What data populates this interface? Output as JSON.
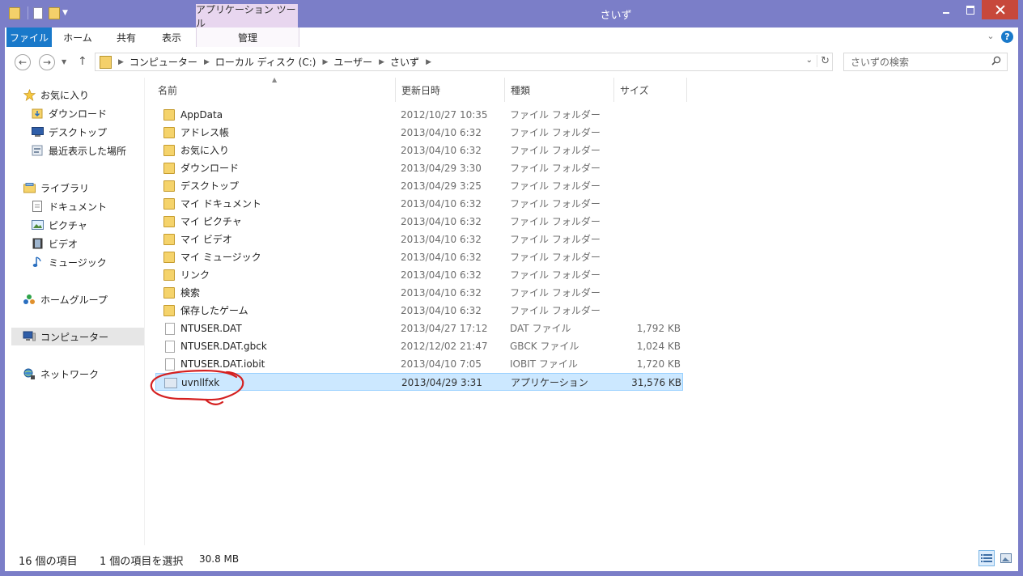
{
  "window": {
    "title": "さいず",
    "context_tab_title": "アプリケーション ツール"
  },
  "ribbon": {
    "tabs": [
      {
        "label": "ファイル"
      },
      {
        "label": "ホーム"
      },
      {
        "label": "共有"
      },
      {
        "label": "表示"
      },
      {
        "label": "管理"
      }
    ],
    "help": "?"
  },
  "address": {
    "crumbs": [
      "コンピューター",
      "ローカル ディスク (C:)",
      "ユーザー",
      "さいず"
    ]
  },
  "search": {
    "placeholder": "さいずの検索"
  },
  "nav": {
    "items": [
      {
        "label": "お気に入り"
      },
      {
        "label": "ダウンロード"
      },
      {
        "label": "デスクトップ"
      },
      {
        "label": "最近表示した場所"
      },
      {
        "label": "ライブラリ"
      },
      {
        "label": "ドキュメント"
      },
      {
        "label": "ピクチャ"
      },
      {
        "label": "ビデオ"
      },
      {
        "label": "ミュージック"
      },
      {
        "label": "ホームグループ"
      },
      {
        "label": "コンピューター"
      },
      {
        "label": "ネットワーク"
      }
    ]
  },
  "columns": {
    "name": "名前",
    "date": "更新日時",
    "type": "種類",
    "size": "サイズ"
  },
  "files": [
    {
      "name": "AppData",
      "date": "2012/10/27 10:35",
      "type": "ファイル フォルダー",
      "size": ""
    },
    {
      "name": "アドレス帳",
      "date": "2013/04/10 6:32",
      "type": "ファイル フォルダー",
      "size": ""
    },
    {
      "name": "お気に入り",
      "date": "2013/04/10 6:32",
      "type": "ファイル フォルダー",
      "size": ""
    },
    {
      "name": "ダウンロード",
      "date": "2013/04/29 3:30",
      "type": "ファイル フォルダー",
      "size": ""
    },
    {
      "name": "デスクトップ",
      "date": "2013/04/29 3:25",
      "type": "ファイル フォルダー",
      "size": ""
    },
    {
      "name": "マイ ドキュメント",
      "date": "2013/04/10 6:32",
      "type": "ファイル フォルダー",
      "size": ""
    },
    {
      "name": "マイ ピクチャ",
      "date": "2013/04/10 6:32",
      "type": "ファイル フォルダー",
      "size": ""
    },
    {
      "name": "マイ ビデオ",
      "date": "2013/04/10 6:32",
      "type": "ファイル フォルダー",
      "size": ""
    },
    {
      "name": "マイ ミュージック",
      "date": "2013/04/10 6:32",
      "type": "ファイル フォルダー",
      "size": ""
    },
    {
      "name": "リンク",
      "date": "2013/04/10 6:32",
      "type": "ファイル フォルダー",
      "size": ""
    },
    {
      "name": "検索",
      "date": "2013/04/10 6:32",
      "type": "ファイル フォルダー",
      "size": ""
    },
    {
      "name": "保存したゲーム",
      "date": "2013/04/10 6:32",
      "type": "ファイル フォルダー",
      "size": ""
    },
    {
      "name": "NTUSER.DAT",
      "date": "2013/04/27 17:12",
      "type": "DAT ファイル",
      "size": "1,792 KB"
    },
    {
      "name": "NTUSER.DAT.gbck",
      "date": "2012/12/02 21:47",
      "type": "GBCK ファイル",
      "size": "1,024 KB"
    },
    {
      "name": "NTUSER.DAT.iobit",
      "date": "2013/04/10 7:05",
      "type": "IOBIT ファイル",
      "size": "1,720 KB"
    },
    {
      "name": "uvnllfxk",
      "date": "2013/04/29 3:31",
      "type": "アプリケーション",
      "size": "31,576 KB"
    }
  ],
  "status": {
    "count": "16 個の項目",
    "selected": "1 個の項目を選択",
    "selected_size": "30.8 MB"
  },
  "colors": {
    "titlebar": "#7b7ec8",
    "file_tab": "#1979ca",
    "close_button": "#c7483b",
    "context_tab": "#e8d6ef",
    "selection": "#cce8ff",
    "annotation": "#d42020"
  }
}
